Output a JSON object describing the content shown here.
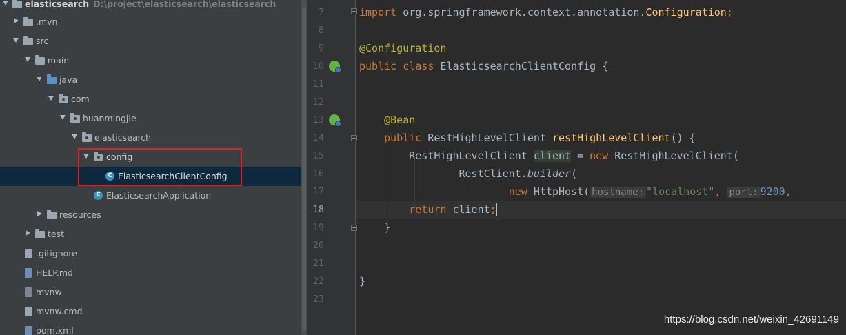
{
  "project_tree": {
    "root_name": "elasticsearch",
    "root_path": "D:\\project\\elasticsearch\\elasticsearch",
    "items": [
      {
        "label": ".mvn"
      },
      {
        "label": "src"
      },
      {
        "label": "main"
      },
      {
        "label": "java"
      },
      {
        "label": "com"
      },
      {
        "label": "huanmingjie"
      },
      {
        "label": "elasticsearch"
      },
      {
        "label": "config"
      },
      {
        "label": "ElasticsearchClientConfig"
      },
      {
        "label": "ElasticsearchApplication"
      },
      {
        "label": "resources"
      },
      {
        "label": "test"
      },
      {
        "label": ".gitignore"
      },
      {
        "label": "HELP.md"
      },
      {
        "label": "mvnw"
      },
      {
        "label": "mvnw.cmd"
      },
      {
        "label": "pom.xml"
      }
    ]
  },
  "editor": {
    "line_numbers": [
      "7",
      "8",
      "9",
      "10",
      "11",
      "12",
      "13",
      "14",
      "15",
      "16",
      "17",
      "18",
      "19",
      "20",
      "21",
      "22",
      "23"
    ],
    "tokens": {
      "import_kw": "import",
      "import_path": " org.springframework.context.annotation.",
      "import_class": "Configuration",
      "semicolon": ";",
      "annotation_configuration": "@Configuration",
      "public": "public",
      "class": "class",
      "class_name": " ElasticsearchClientConfig {",
      "annotation_bean": "@Bean",
      "return_type": " RestHighLevelClient ",
      "method_name": "restHighLevelClient",
      "method_sig": "() {",
      "var_type": "RestHighLevelClient ",
      "var_name": "client",
      "assign": " = ",
      "new": "new",
      "ctor": " RestHighLevelClient(",
      "builder_prefix": "RestClient.",
      "builder_method": "builder",
      "builder_paren": "(",
      "httphost": " HttpHost(",
      "hint_hostname": "hostname:",
      "host_value": "\"localhost\"",
      "comma": ", ",
      "hint_port": "port:",
      "port_value": "9200",
      "comma2": ",",
      "return_kw": "return",
      "return_val": " client",
      "close_brace": "}"
    }
  },
  "watermark": "https://blog.csdn.net/weixin_42691149"
}
